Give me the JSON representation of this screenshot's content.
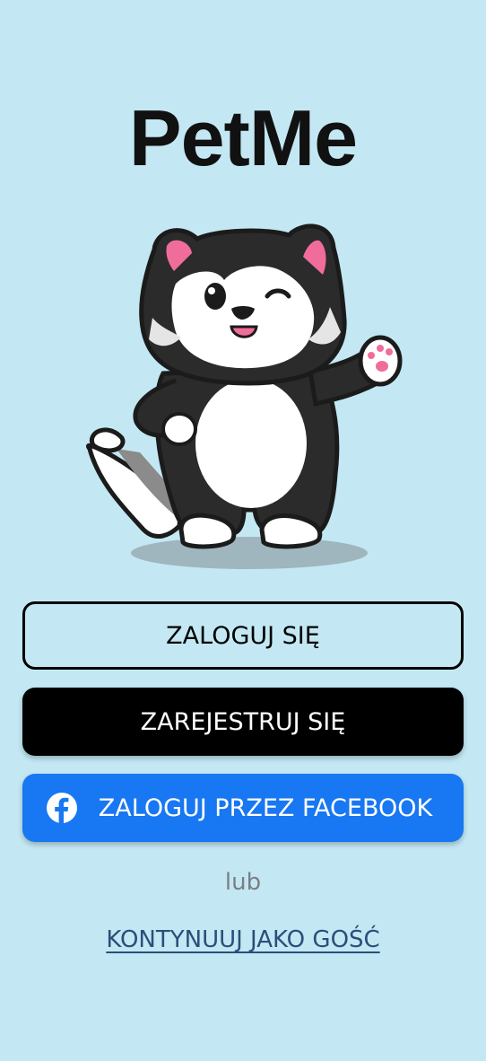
{
  "app": {
    "title": "PetMe"
  },
  "mascot": {
    "icon": "winking-cat-mascot"
  },
  "actions": {
    "login_label": "ZALOGUJ SIĘ",
    "register_label": "ZAREJESTRUJ SIĘ",
    "facebook_label": "ZALOGUJ PRZEZ FACEBOOK",
    "facebook_icon": "facebook-icon",
    "or_label": "lub",
    "guest_label": "KONTYNUUJ JAKO GOŚĆ"
  },
  "colors": {
    "background": "#c3e8f3",
    "primary_button": "#000000",
    "facebook_blue": "#1877f2",
    "guest_link": "#2a4f7a"
  }
}
